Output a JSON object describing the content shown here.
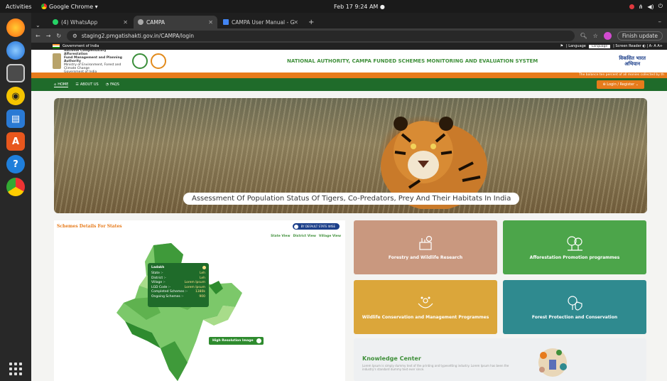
{
  "os": {
    "activities": "Activities",
    "app_name": "Google Chrome ▾",
    "clock": "Feb 17  9:24 AM  ●"
  },
  "browser": {
    "tabs": [
      {
        "label": "(4) WhatsApp",
        "active": false
      },
      {
        "label": "CAMPA",
        "active": true
      },
      {
        "label": "CAMPA User Manual - G",
        "active": false
      }
    ],
    "url": "staging2.pmgatishakti.gov.in/CAMPA/login",
    "finish_update": "Finish update"
  },
  "site": {
    "gov_strip": "Government of India",
    "gov_right": "| Language",
    "screen_reader": "| Screen Reader  ◐  |  A-  A  A+",
    "language_select": "Language",
    "ministry_lines": [
      "National Compensatory Afforestation",
      "Fund Management and Planning Authority",
      "Ministry of Environment, Forest and Climate Change",
      "Government of India"
    ],
    "header_title": "NATIONAL AUTHORITY, CAMPA FUNDED SCHEMES MONITORING AND EVALUATION SYSTEM",
    "viksit": "विकसित भारत",
    "abhiyan": "अभियान",
    "ticker": "The balance ten percent of all monies collected by th",
    "nav": {
      "home": "HOME",
      "about": "ABOUT US",
      "faqs": "FAQS",
      "login": "Login / Register"
    },
    "hero_caption": "Assessment Of Population Status Of Tigers, Co-Predators, Prey And Their Habitats In India",
    "schemes_title": "Schemes Details For States",
    "toggle": "BY DEFAULT STATE WISE",
    "views": [
      "State View",
      "District View",
      "Village View"
    ],
    "tooltip": {
      "title": "Ladakh",
      "rows": [
        {
          "k": "State :-",
          "v": "Leh"
        },
        {
          "k": "District :-",
          "v": "Leh"
        },
        {
          "k": "Village :-",
          "v": "Lorem Ipsum"
        },
        {
          "k": "LGD Code :-",
          "v": "Lorem Ipsum"
        },
        {
          "k": "Completed Schemes :-",
          "v": "1380k"
        },
        {
          "k": "Ongoing Schemes :-",
          "v": "900"
        }
      ]
    },
    "hires": "High Resolution Image",
    "tiles": [
      {
        "label": "Forestry and Wildlife Research",
        "color": "#c9987f"
      },
      {
        "label": "Afforestation Promotion programmes",
        "color": "#4ca54a"
      },
      {
        "label": "Wildlife Conservation and Management Programmes",
        "color": "#dba63a"
      },
      {
        "label": "Forest Protection and Conservation",
        "color": "#2f8a8f"
      }
    ],
    "knowledge": {
      "title": "Knowledge Center",
      "text": "Lorem Ipsum is simply dummy text of the printing and typesetting industry. Lorem Ipsum has been the industry's standard dummy text ever since."
    }
  }
}
